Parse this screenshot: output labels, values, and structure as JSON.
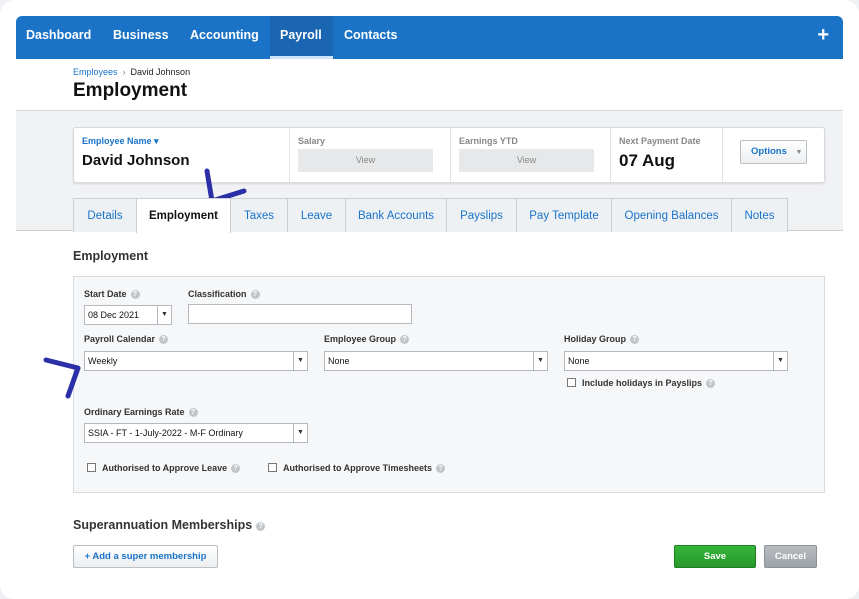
{
  "nav": {
    "items": [
      {
        "label": "Dashboard"
      },
      {
        "label": "Business"
      },
      {
        "label": "Accounting"
      },
      {
        "label": "Payroll"
      },
      {
        "label": "Contacts"
      }
    ],
    "plus": "+"
  },
  "breadcrumb": {
    "parent": "Employees",
    "separator": "›",
    "current": "David Johnson"
  },
  "page_title": "Employment",
  "summary": {
    "employee_name_label": "Employee Name ▾",
    "employee_name": "David Johnson",
    "salary_label": "Salary",
    "salary_view": "View",
    "earnings_label": "Earnings YTD",
    "earnings_view": "View",
    "next_payment_label": "Next Payment Date",
    "next_payment_value": "07 Aug",
    "options_label": "Options"
  },
  "tabs": [
    {
      "label": "Details"
    },
    {
      "label": "Employment"
    },
    {
      "label": "Taxes"
    },
    {
      "label": "Leave"
    },
    {
      "label": "Bank Accounts"
    },
    {
      "label": "Payslips"
    },
    {
      "label": "Pay Template"
    },
    {
      "label": "Opening Balances"
    },
    {
      "label": "Notes"
    }
  ],
  "employment": {
    "section_title": "Employment",
    "start_date_label": "Start Date",
    "start_date_value": "08 Dec 2021",
    "classification_label": "Classification",
    "classification_value": "",
    "payroll_calendar_label": "Payroll Calendar",
    "payroll_calendar_value": "Weekly",
    "employee_group_label": "Employee Group",
    "employee_group_value": "None",
    "holiday_group_label": "Holiday Group",
    "holiday_group_value": "None",
    "include_holidays_label": "Include holidays in Payslips",
    "ordinary_earnings_label": "Ordinary Earnings Rate",
    "ordinary_earnings_value": "SSIA - FT - 1-July-2022 - M-F Ordinary",
    "approve_leave_label": "Authorised to Approve Leave",
    "approve_timesheets_label": "Authorised to Approve Timesheets"
  },
  "super": {
    "section_title": "Superannuation Memberships",
    "add_label": "+ Add a super membership"
  },
  "actions": {
    "save": "Save",
    "cancel": "Cancel"
  },
  "colors": {
    "nav_blue": "#1b73c8",
    "save_green": "#2ea832",
    "annotation": "#2b2fa8"
  }
}
